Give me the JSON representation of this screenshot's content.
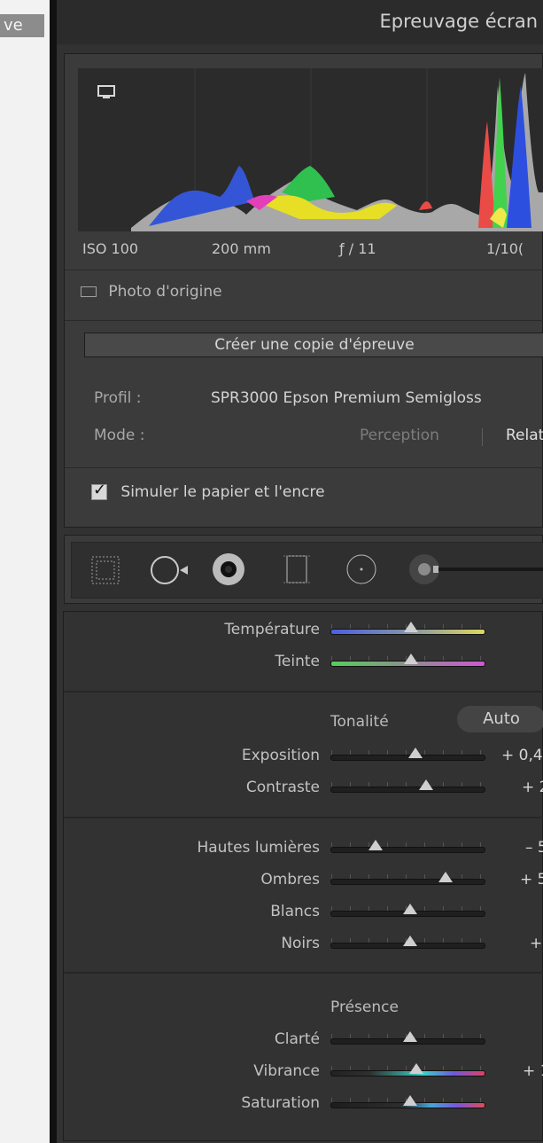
{
  "left_panel": {
    "tab_label": "ve"
  },
  "header": {
    "title": "Epreuvage écran"
  },
  "histogram": {
    "exif": {
      "iso": "ISO 100",
      "focal": "200 mm",
      "aperture": "ƒ / 11",
      "shutter": "1/10("
    }
  },
  "proof": {
    "original_label": "Photo d'origine",
    "copy_button": "Créer une copie d'épreuve",
    "profile_label": "Profil :",
    "profile_value": "SPR3000 Epson Premium Semigloss",
    "mode_label": "Mode :",
    "mode_perception": "Perception",
    "mode_relative": "Relat",
    "simulate_label": "Simuler le papier et l'encre",
    "simulate_checked": true
  },
  "tools": [
    "crop-tool-icon",
    "spot-removal-icon",
    "red-eye-icon",
    "graduated-filter-icon",
    "radial-filter-icon",
    "adjustment-brush-icon"
  ],
  "basic": {
    "temperature": {
      "label": "Température",
      "position": 0.52
    },
    "tint": {
      "label": "Teinte",
      "position": 0.52
    },
    "tone_title": "Tonalité",
    "auto_label": "Auto",
    "exposure": {
      "label": "Exposition",
      "value": "+ 0,4",
      "position": 0.55
    },
    "contrast": {
      "label": "Contraste",
      "value": "+ 2",
      "position": 0.62
    },
    "highlights": {
      "label": "Hautes lumières",
      "value": "– 5",
      "position": 0.3
    },
    "shadows": {
      "label": "Ombres",
      "value": "+ 5",
      "position": 0.75
    },
    "whites": {
      "label": "Blancs",
      "value": "",
      "position": 0.52
    },
    "blacks": {
      "label": "Noirs",
      "value": "+",
      "position": 0.52
    },
    "presence_title": "Présence",
    "clarity": {
      "label": "Clarté",
      "position": 0.52
    },
    "vibrance": {
      "label": "Vibrance",
      "value": "+ 1",
      "position": 0.56
    },
    "saturation": {
      "label": "Saturation",
      "position": 0.52
    }
  }
}
